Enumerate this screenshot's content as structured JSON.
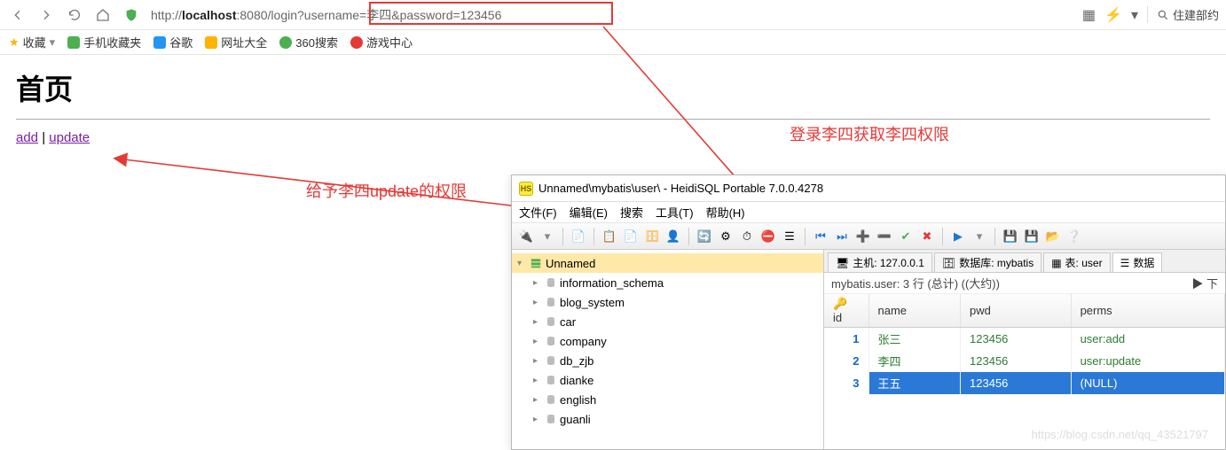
{
  "url": {
    "prefix": "http://",
    "host": "localhost",
    "port_path": ":8080/login",
    "query": "?username=李四&password=123456"
  },
  "search_right": "住建部约",
  "bookmarks": {
    "fav": "收藏",
    "items": [
      "手机收藏夹",
      "谷歌",
      "网址大全",
      "360搜索",
      "游戏中心"
    ]
  },
  "page": {
    "title": "首页",
    "link_add": "add",
    "link_sep": " | ",
    "link_update": "update"
  },
  "annotations": {
    "a1": "登录李四获取李四权限",
    "a2": "给予李四update的权限"
  },
  "heidi": {
    "title": "Unnamed\\mybatis\\user\\ - HeidiSQL Portable 7.0.0.4278",
    "menu": [
      "文件(F)",
      "编辑(E)",
      "搜索",
      "工具(T)",
      "帮助(H)"
    ],
    "tree": {
      "root": "Unnamed",
      "children": [
        "information_schema",
        "blog_system",
        "car",
        "company",
        "db_zjb",
        "dianke",
        "english",
        "guanli"
      ]
    },
    "tabs": {
      "host_label": "主机: 127.0.0.1",
      "db_label": "数据库: mybatis",
      "table_label": "表: user",
      "data_label": "数据"
    },
    "caption": "mybatis.user: 3 行 (总计) ((大约))",
    "caption_right": "下",
    "columns": [
      "id",
      "name",
      "pwd",
      "perms"
    ],
    "rows": [
      {
        "id": "1",
        "name": "张三",
        "pwd": "123456",
        "perms": "user:add",
        "sel": false
      },
      {
        "id": "2",
        "name": "李四",
        "pwd": "123456",
        "perms": "user:update",
        "sel": false
      },
      {
        "id": "3",
        "name": "王五",
        "pwd": "123456",
        "perms": "(NULL)",
        "sel": true
      }
    ]
  },
  "watermark": "https://blog.csdn.net/qq_43521797"
}
